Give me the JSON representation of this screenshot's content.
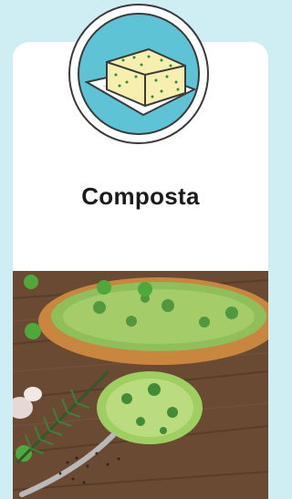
{
  "product": {
    "title": "Composta",
    "icon": "butter-block-icon",
    "photo": "herb-butter-bread-photo"
  },
  "colors": {
    "page_background": "#cfeef3",
    "badge_circle": "#5ec3d5",
    "outline": "#3b3b3b",
    "card": "#ffffff",
    "title_text": "#1b1b1b"
  }
}
